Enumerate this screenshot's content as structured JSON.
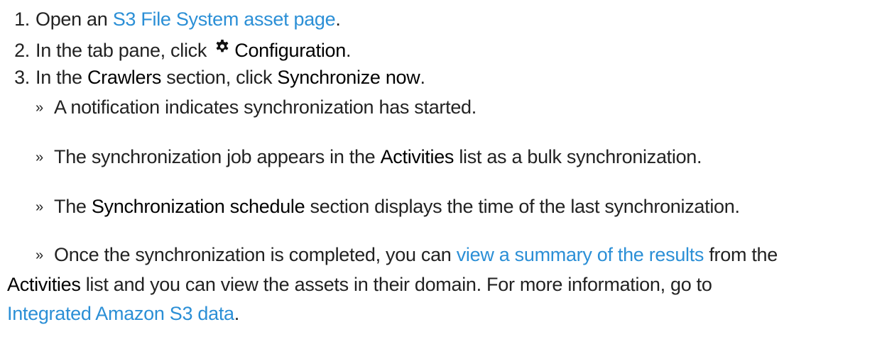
{
  "steps": [
    {
      "num": "1.",
      "pre": "Open an ",
      "link": "S3 File System asset page",
      "post": "."
    },
    {
      "num": "2.",
      "pre": "In the tab pane, click ",
      "icon": "gear-icon",
      "ui": "Configuration",
      "post": "."
    },
    {
      "num": "3.",
      "pre": "In the ",
      "ui1": "Crawlers",
      "mid": " section, click ",
      "ui2": "Synchronize now",
      "post": "."
    }
  ],
  "results": [
    {
      "chev": "»",
      "text": "A notification indicates synchronization has started."
    },
    {
      "chev": "»",
      "pre": "The synchronization job appears in the ",
      "ui": "Activities",
      "post": " list as a bulk synchronization."
    },
    {
      "chev": "»",
      "pre": "The ",
      "ui": "Synchronization schedule",
      "post": " section displays the time of the last synchronization."
    },
    {
      "chev": "»",
      "pre": "Once the synchronization is completed, you can ",
      "link1": "view a summary of the results",
      "mid1": " from the ",
      "ui": "Activities",
      "mid2": " list and you can view the assets in their domain. For more information, go to ",
      "link2": "Integrated Amazon S3 data",
      "post": "."
    }
  ],
  "colors": {
    "link": "#2b8fd6",
    "text": "#222222"
  }
}
